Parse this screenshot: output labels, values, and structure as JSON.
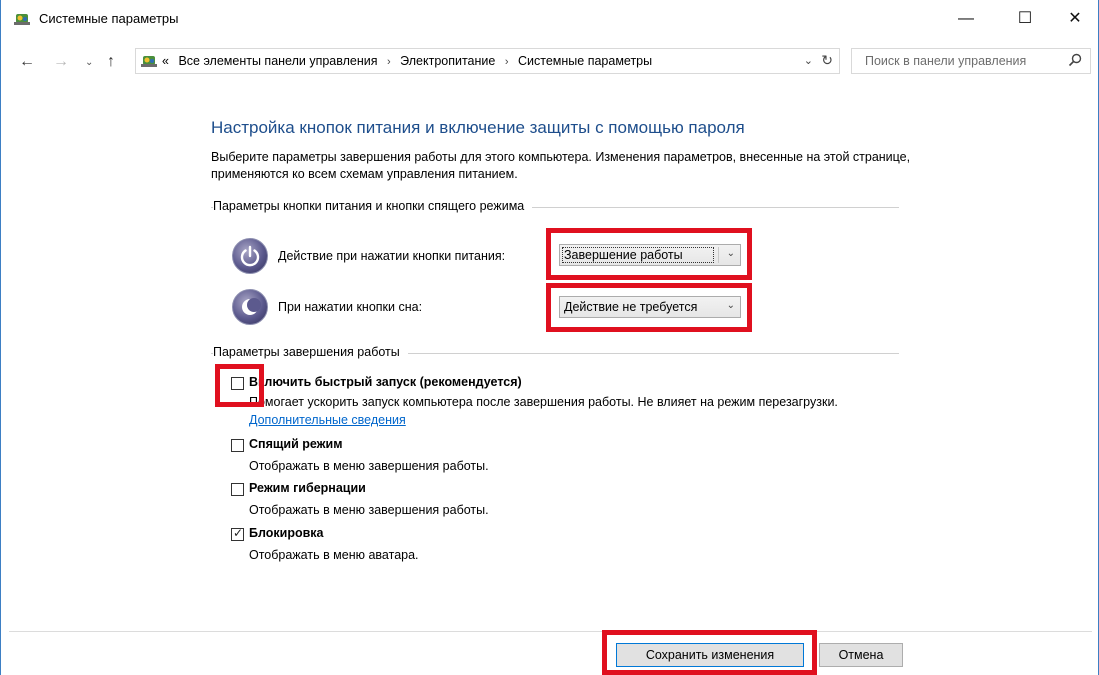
{
  "window": {
    "title": "Системные параметры",
    "minimize_glyph": "—",
    "maximize_glyph": "☐",
    "close_glyph": "✕"
  },
  "nav": {
    "back_glyph": "←",
    "forward_glyph": "→",
    "history_glyph": "⌄",
    "up_glyph": "↑",
    "address_prefix": "«",
    "breadcrumbs": [
      "Все элементы панели управления",
      "Электропитание",
      "Системные параметры"
    ],
    "crumb_separator": "›",
    "dropdown_glyph": "⌄",
    "refresh_glyph": "↻",
    "search_placeholder": "Поиск в панели управления"
  },
  "main": {
    "heading": "Настройка кнопок питания и включение защиты с помощью пароля",
    "description": "Выберите параметры завершения работы для этого компьютера. Изменения параметров, внесенные на этой странице, применяются ко всем схемам управления питанием.",
    "power_group": {
      "label": "Параметры кнопки питания и кнопки спящего режима",
      "power_button": {
        "label": "Действие при нажатии кнопки питания:",
        "value": "Завершение работы"
      },
      "sleep_button": {
        "label": "При нажатии кнопки сна:",
        "value": "Действие не требуется"
      }
    },
    "shutdown_group": {
      "label": "Параметры завершения работы",
      "options": [
        {
          "title": "Включить быстрый запуск (рекомендуется)",
          "desc": "Помогает ускорить запуск компьютера после завершения работы. Не влияет на режим перезагрузки.",
          "link": "Дополнительные сведения",
          "checked": false
        },
        {
          "title": "Спящий режим",
          "desc": "Отображать в меню завершения работы.",
          "checked": false
        },
        {
          "title": "Режим гибернации",
          "desc": "Отображать в меню завершения работы.",
          "checked": false
        },
        {
          "title": "Блокировка",
          "desc": "Отображать в меню аватара.",
          "checked": true
        }
      ]
    }
  },
  "footer": {
    "save_label": "Сохранить изменения",
    "cancel_label": "Отмена"
  },
  "icons": {
    "window_icon": "control-panel-icon",
    "power_icon": "power-icon",
    "sleep_icon": "sleep-moon-icon",
    "search_icon": "search-icon",
    "check_glyph": "✓"
  },
  "colors": {
    "heading": "#1e4e8c",
    "link": "#0066cc",
    "highlight": "#e0101f",
    "window_border": "#3d7fc4"
  }
}
